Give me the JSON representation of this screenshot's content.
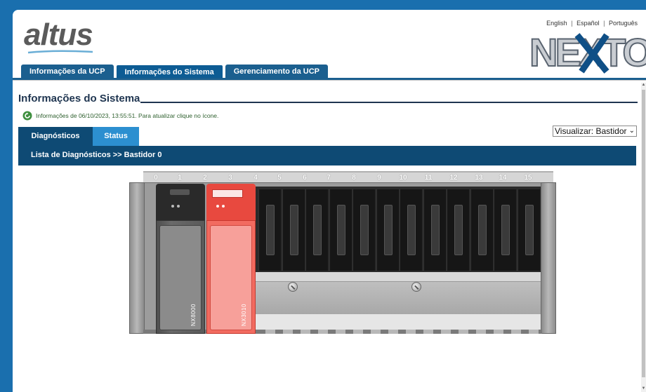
{
  "brand": {
    "logo": "altus",
    "product_logo": "NEXTO"
  },
  "languages": [
    "English",
    "Español",
    "Português"
  ],
  "language_separator": "|",
  "main_tabs": [
    {
      "label": "Informações da UCP",
      "active": false
    },
    {
      "label": "Informações do Sistema",
      "active": true
    },
    {
      "label": "Gerenciamento da UCP",
      "active": false
    }
  ],
  "page": {
    "title": "Informações do Sistema",
    "info_text": "Informações de 06/10/2023, 13:55:51. Para atualizar clique no ícone.",
    "refresh_icon": "refresh-icon"
  },
  "view_select": {
    "value": "Visualizar: Bastidor"
  },
  "sub_tabs": [
    {
      "label": "Diagnósticos",
      "active": true
    },
    {
      "label": "Status",
      "active": false
    }
  ],
  "diag_header": "Lista de Diagnósticos >> Bastidor 0",
  "rack": {
    "slot_numbers": [
      "0",
      "1",
      "2",
      "3",
      "4",
      "5",
      "6",
      "7",
      "8",
      "9",
      "10",
      "11",
      "12",
      "13",
      "14",
      "15"
    ],
    "modules": [
      {
        "name": "NX8000",
        "color": "#5a5a5a"
      },
      {
        "name": "NX3010",
        "color": "#f26b60"
      }
    ],
    "empty_slot_count": 12
  },
  "colors": {
    "frame_blue": "#1a6fae",
    "tab_blue": "#1b5f8f",
    "header_dark": "#0e4a74",
    "status_blue": "#2c8fd0",
    "info_green": "#2d5f2d"
  }
}
